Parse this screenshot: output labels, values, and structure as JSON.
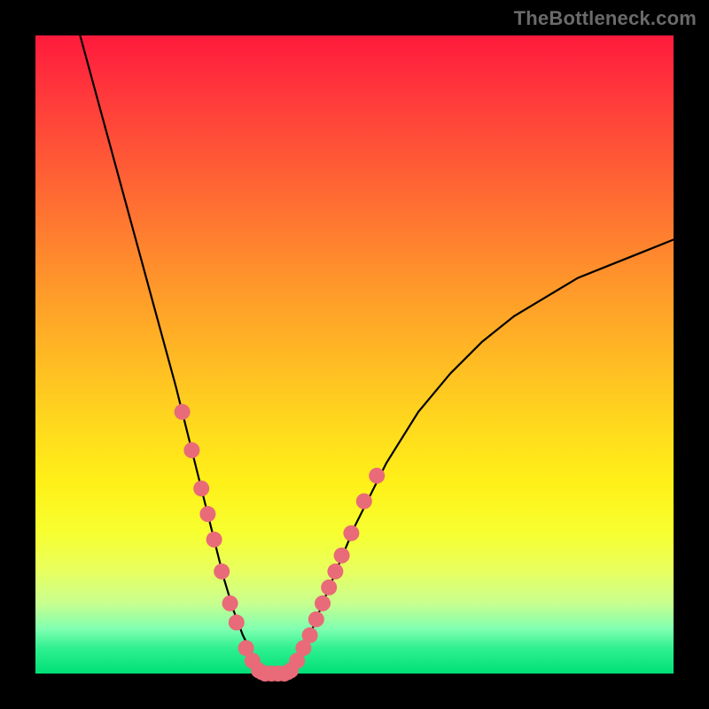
{
  "watermark": "TheBottleneck.com",
  "chart_data": {
    "type": "line",
    "title": "",
    "xlabel": "",
    "ylabel": "",
    "xlim": [
      0,
      100
    ],
    "ylim": [
      0,
      100
    ],
    "grid": false,
    "legend": null,
    "series": [
      {
        "name": "curve",
        "x": [
          7,
          10,
          13,
          16,
          19,
          22,
          23.5,
          25,
          26.5,
          28,
          29.5,
          31,
          32.5,
          34,
          35.5,
          37,
          39,
          41,
          43,
          45,
          50,
          55,
          60,
          65,
          70,
          75,
          80,
          85,
          90,
          95,
          100
        ],
        "y": [
          100,
          89,
          78,
          67,
          56,
          45,
          39,
          33,
          27,
          21,
          15,
          10,
          6,
          3,
          1,
          0,
          0,
          2,
          6,
          11,
          23,
          33,
          41,
          47,
          52,
          56,
          59,
          62,
          64,
          66,
          68
        ]
      }
    ],
    "trough": {
      "x_start": 35,
      "x_end": 40,
      "y": 0
    },
    "scatter_points": [
      {
        "x": 23.0,
        "y": 41
      },
      {
        "x": 24.5,
        "y": 35
      },
      {
        "x": 26.0,
        "y": 29
      },
      {
        "x": 27.0,
        "y": 25
      },
      {
        "x": 28.0,
        "y": 21
      },
      {
        "x": 29.2,
        "y": 16
      },
      {
        "x": 30.5,
        "y": 11
      },
      {
        "x": 31.5,
        "y": 8
      },
      {
        "x": 33.0,
        "y": 4
      },
      {
        "x": 34.0,
        "y": 2
      },
      {
        "x": 35.0,
        "y": 0.5
      },
      {
        "x": 36.0,
        "y": 0
      },
      {
        "x": 37.0,
        "y": 0
      },
      {
        "x": 38.0,
        "y": 0
      },
      {
        "x": 39.0,
        "y": 0
      },
      {
        "x": 40.0,
        "y": 0.5
      },
      {
        "x": 41.0,
        "y": 2
      },
      {
        "x": 42.0,
        "y": 4
      },
      {
        "x": 43.0,
        "y": 6
      },
      {
        "x": 44.0,
        "y": 8.5
      },
      {
        "x": 45.0,
        "y": 11
      },
      {
        "x": 46.0,
        "y": 13.5
      },
      {
        "x": 47.0,
        "y": 16
      },
      {
        "x": 48.0,
        "y": 18.5
      },
      {
        "x": 49.5,
        "y": 22
      },
      {
        "x": 51.5,
        "y": 27
      },
      {
        "x": 53.5,
        "y": 31
      }
    ],
    "colors": {
      "curve": "#000000",
      "dots": "#e96a78",
      "gradient_top": "#ff1a3c",
      "gradient_bottom": "#00e078"
    }
  }
}
